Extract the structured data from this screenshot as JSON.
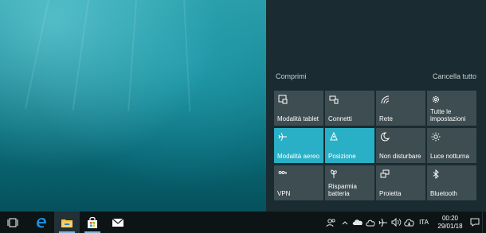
{
  "action_center": {
    "collapse_label": "Comprimi",
    "clear_all_label": "Cancella tutto",
    "tiles": [
      {
        "label": "Modalità tablet",
        "icon": "tablet-mode-icon",
        "active": false
      },
      {
        "label": "Connetti",
        "icon": "connect-icon",
        "active": false
      },
      {
        "label": "Rete",
        "icon": "network-icon",
        "active": false
      },
      {
        "label": "Tutte le impostazioni",
        "icon": "settings-icon",
        "active": false
      },
      {
        "label": "Modalità aereo",
        "icon": "airplane-icon",
        "active": true
      },
      {
        "label": "Posizione",
        "icon": "location-icon",
        "active": true
      },
      {
        "label": "Non disturbare",
        "icon": "moon-icon",
        "active": false
      },
      {
        "label": "Luce notturna",
        "icon": "brightness-icon",
        "active": false
      },
      {
        "label": "VPN",
        "icon": "vpn-icon",
        "active": false
      },
      {
        "label": "Risparmia batteria",
        "icon": "battery-saver-icon",
        "active": false
      },
      {
        "label": "Proietta",
        "icon": "project-icon",
        "active": false
      },
      {
        "label": "Bluetooth",
        "icon": "bluetooth-icon",
        "active": false
      }
    ],
    "colors": {
      "panel": "#1a2b31",
      "tile": "#3e4d52",
      "tile_active": "#2ab0c6"
    }
  },
  "taskbar": {
    "language": "ITA",
    "time": "00:20",
    "date": "29/01/18",
    "apps": [
      "task-view-icon",
      "edge-icon",
      "file-explorer-icon",
      "store-icon",
      "mail-icon"
    ]
  }
}
